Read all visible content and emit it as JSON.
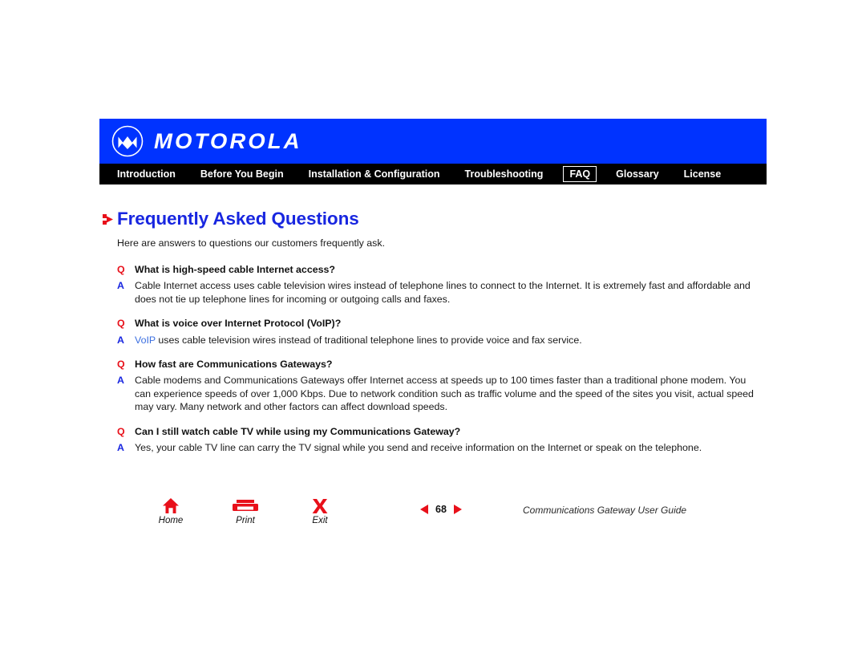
{
  "brand": {
    "logo_icon": "motorola-m-logo",
    "wordmark": "MOTOROLA",
    "bar_color": "#0033ff"
  },
  "nav": {
    "items": [
      {
        "label": "Introduction",
        "active": false
      },
      {
        "label": "Before You Begin",
        "active": false
      },
      {
        "label": "Installation & Configuration",
        "active": false
      },
      {
        "label": "Troubleshooting",
        "active": false
      },
      {
        "label": "FAQ",
        "active": true
      },
      {
        "label": "Glossary",
        "active": false
      },
      {
        "label": "License",
        "active": false
      }
    ],
    "bar_color": "#000000"
  },
  "content": {
    "bullet_icon": "red-arrow-bullet",
    "title": "Frequently Asked Questions",
    "title_color": "#1826e0",
    "intro": "Here are answers to questions our customers frequently ask.",
    "q_marker": "Q",
    "a_marker": "A",
    "q_color": "#e8101a",
    "a_color": "#1826e0",
    "faqs": [
      {
        "question": "What is high-speed cable Internet access?",
        "answer": "Cable Internet access uses cable television wires instead of telephone lines to connect to the Internet. It is extremely fast and affordable and does not tie up telephone lines for incoming or outgoing calls and faxes.",
        "link": null,
        "answer_rest": null
      },
      {
        "question": "What is voice over Internet Protocol (VoIP)?",
        "answer": "VoIP uses cable television wires instead of traditional telephone lines to provide voice and fax service.",
        "link": "VoIP",
        "answer_rest": " uses cable television wires instead of traditional telephone lines to provide voice and fax service."
      },
      {
        "question": "How fast are Communications Gateways?",
        "answer": "Cable modems and Communications Gateways offer Internet access at speeds up to 100 times faster than a traditional phone modem. You can experience speeds of over 1,000 Kbps. Due to network condition such as traffic volume and the speed of the sites you visit, actual speed may vary. Many network and other factors can affect download speeds.",
        "link": null,
        "answer_rest": null
      },
      {
        "question": "Can I still watch cable TV while using my Communications Gateway?",
        "answer": "Yes, your cable TV line can carry the TV signal while you send and receive information on the Internet or speak on the telephone.",
        "link": null,
        "answer_rest": null
      }
    ]
  },
  "footer": {
    "tools": [
      {
        "label": "Home",
        "icon": "home-icon"
      },
      {
        "label": "Print",
        "icon": "printer-icon"
      },
      {
        "label": "Exit",
        "icon": "exit-x-icon"
      }
    ],
    "prev_icon": "prev-page-arrow",
    "next_icon": "next-page-arrow",
    "page_number": "68",
    "guide_title": "Communications Gateway User Guide",
    "accent_color": "#e8101a"
  }
}
